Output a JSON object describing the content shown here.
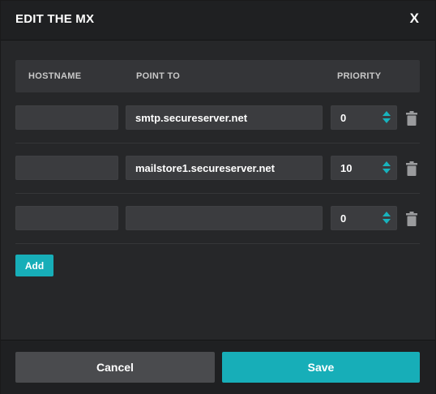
{
  "dialog": {
    "title": "EDIT THE MX",
    "close_label": "X"
  },
  "table": {
    "headers": {
      "hostname": "HOSTNAME",
      "point_to": "POINT TO",
      "priority": "PRIORITY"
    },
    "rows": [
      {
        "hostname": "",
        "point_to": "smtp.secureserver.net",
        "priority": "0"
      },
      {
        "hostname": "",
        "point_to": "mailstore1.secureserver.net",
        "priority": "10"
      },
      {
        "hostname": "",
        "point_to": "",
        "priority": "0"
      }
    ]
  },
  "actions": {
    "add_label": "Add",
    "cancel_label": "Cancel",
    "save_label": "Save"
  },
  "colors": {
    "accent": "#17aeb8",
    "background": "#262729",
    "input": "#3b3c3f",
    "header": "#1f2022"
  },
  "icons": {
    "close": "close-icon",
    "spinner": "spinner-icon",
    "delete": "trash-icon"
  }
}
